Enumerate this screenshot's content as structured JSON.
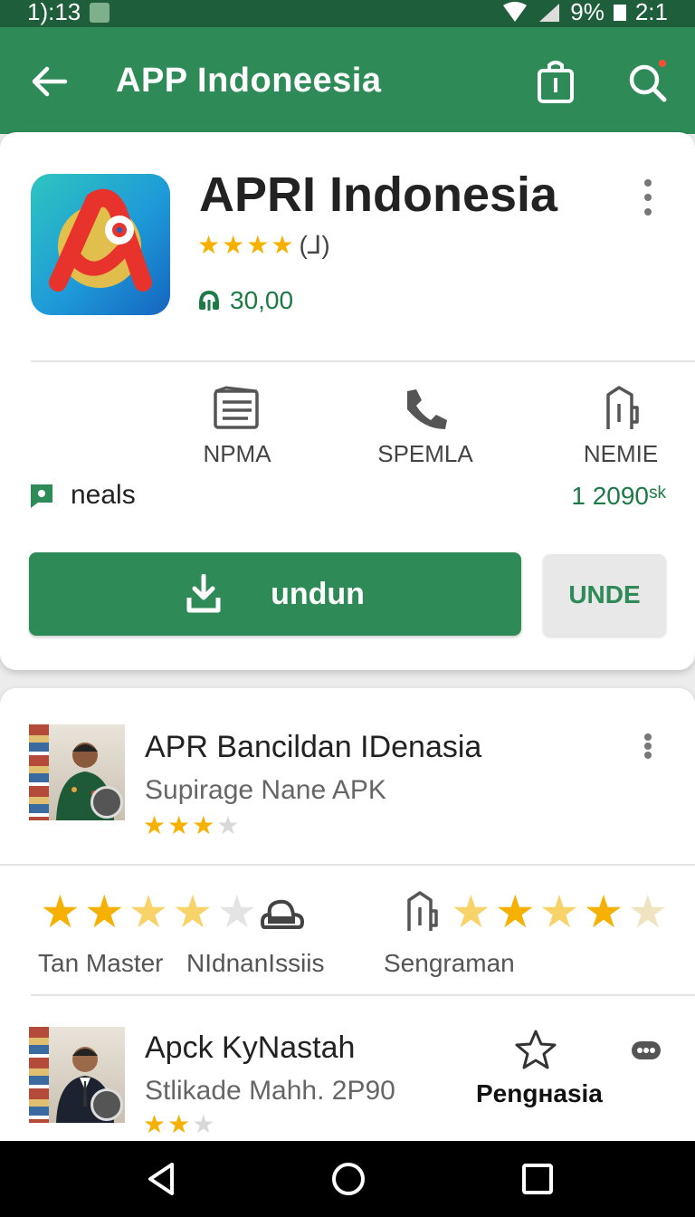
{
  "status_bar": {
    "time": "1):13",
    "battery": "9%",
    "clock_right": "2:1"
  },
  "app_bar": {
    "title": "APP  Indoneesia",
    "back_icon": "arrow-left-icon",
    "bag_icon": "shopping-bag-icon",
    "search_icon": "search-icon"
  },
  "app": {
    "name": "APRI Indonesia",
    "rating_stars": 4,
    "rating_count": "(⅃)",
    "installs": "30,00",
    "features": [
      {
        "label": "NPMA",
        "icon": "list-icon"
      },
      {
        "label": "SPEMLA",
        "icon": "phone-icon"
      },
      {
        "label": "NEMIE",
        "icon": "bookmark-icon"
      }
    ],
    "meta_left": "neals",
    "meta_right": "1 2090ˢᵏ",
    "install_label": "undun",
    "secondary_label": "UNDE"
  },
  "list": {
    "items": [
      {
        "title": "APR Bancildan IDenasia",
        "subtitle": "Supirage Nane APK",
        "stars": 3
      },
      {
        "title": "Apck KyNastah",
        "subtitle": "Stlikade Mahh.  2P90",
        "stars": 2,
        "action_label": "Pengнasia"
      }
    ],
    "rating_labels": [
      "Tan Master",
      "NIdnanIssiis",
      "Sengraman"
    ]
  },
  "colors": {
    "primary": "#2e8b57",
    "status_bar": "#1f5e3a",
    "star": "#f5b000"
  }
}
